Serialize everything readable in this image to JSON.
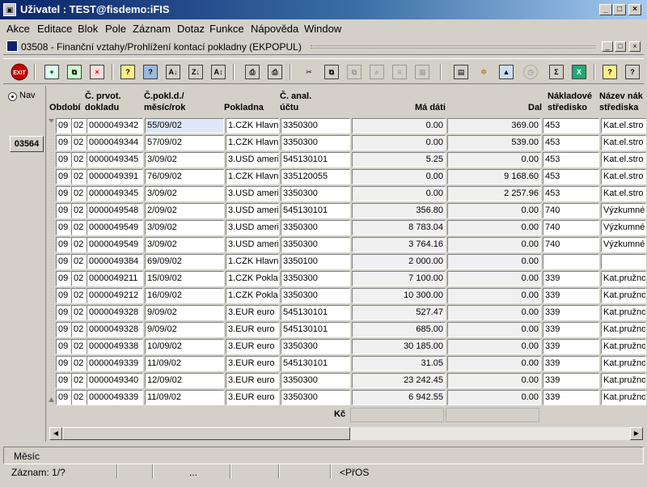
{
  "window": {
    "title": "Uživatel : TEST@fisdemo:iFIS"
  },
  "menu": [
    "Akce",
    "Editace",
    "Blok",
    "Pole",
    "Záznam",
    "Dotaz",
    "Funkce",
    "Nápověda",
    "Window"
  ],
  "form": {
    "title": "03508 - Finanční vztahy/Prohlížení kontací pokladny (EKPOPUL)"
  },
  "toolbar": {
    "exit_label": "EXIT"
  },
  "nav": {
    "label": "Nav",
    "record_button": "03564"
  },
  "columns": {
    "obdobi": "Období",
    "prvot_1": "Č. prvot.",
    "prvot_2": "dokladu",
    "pokl_1": "Č.pokl.d./",
    "pokl_2": "měsíc/rok",
    "pokladna": "Pokladna",
    "anal_1": "Č. anal.",
    "anal_2": "účtu",
    "ma_dati": "Má dáti",
    "dal": "Dal",
    "nakl_1": "Nákladové",
    "nakl_2": "středisko",
    "nazev_1": "Název nák",
    "nazev_2": "střediska"
  },
  "rows": [
    {
      "rok": "09",
      "mes": "02",
      "doklad": "0000049342",
      "pokl_d": "55/09/02",
      "pokladna": "1.CZK Hlavní",
      "ucet": "3350300",
      "md": "0.00",
      "dal": "369.00",
      "stred": "453",
      "nazev": "Kat.el.stro"
    },
    {
      "rok": "09",
      "mes": "02",
      "doklad": "0000049344",
      "pokl_d": "57/09/02",
      "pokladna": "1.CZK Hlavní",
      "ucet": "3350300",
      "md": "0.00",
      "dal": "539.00",
      "stred": "453",
      "nazev": "Kat.el.stro"
    },
    {
      "rok": "09",
      "mes": "02",
      "doklad": "0000049345",
      "pokl_d": "3/09/02",
      "pokladna": "3.USD americ",
      "ucet": "545130101",
      "md": "5.25",
      "dal": "0.00",
      "stred": "453",
      "nazev": "Kat.el.stro"
    },
    {
      "rok": "09",
      "mes": "02",
      "doklad": "0000049391",
      "pokl_d": "76/09/02",
      "pokladna": "1.CZK Hlavní",
      "ucet": "335120055",
      "md": "0.00",
      "dal": "9 168.60",
      "stred": "453",
      "nazev": "Kat.el.stro"
    },
    {
      "rok": "09",
      "mes": "02",
      "doklad": "0000049345",
      "pokl_d": "3/09/02",
      "pokladna": "3.USD americ",
      "ucet": "3350300",
      "md": "0.00",
      "dal": "2 257.96",
      "stred": "453",
      "nazev": "Kat.el.stro"
    },
    {
      "rok": "09",
      "mes": "02",
      "doklad": "0000049548",
      "pokl_d": "2/09/02",
      "pokladna": "3.USD americ",
      "ucet": "545130101",
      "md": "356.80",
      "dal": "0.00",
      "stred": "740",
      "nazev": "Výzkumné"
    },
    {
      "rok": "09",
      "mes": "02",
      "doklad": "0000049549",
      "pokl_d": "3/09/02",
      "pokladna": "3.USD americ",
      "ucet": "3350300",
      "md": "8 783.04",
      "dal": "0.00",
      "stred": "740",
      "nazev": "Výzkumné"
    },
    {
      "rok": "09",
      "mes": "02",
      "doklad": "0000049549",
      "pokl_d": "3/09/02",
      "pokladna": "3.USD americ",
      "ucet": "3350300",
      "md": "3 764.16",
      "dal": "0.00",
      "stred": "740",
      "nazev": "Výzkumné"
    },
    {
      "rok": "09",
      "mes": "02",
      "doklad": "0000049384",
      "pokl_d": "69/09/02",
      "pokladna": "1.CZK Hlavní",
      "ucet": "3350100",
      "md": "2 000.00",
      "dal": "0.00",
      "stred": "",
      "nazev": ""
    },
    {
      "rok": "09",
      "mes": "02",
      "doklad": "0000049211",
      "pokl_d": "15/09/02",
      "pokladna": "1.CZK Poklac",
      "ucet": "3350300",
      "md": "7 100.00",
      "dal": "0.00",
      "stred": "339",
      "nazev": "Kat.pružno"
    },
    {
      "rok": "09",
      "mes": "02",
      "doklad": "0000049212",
      "pokl_d": "16/09/02",
      "pokladna": "1.CZK Poklac",
      "ucet": "3350300",
      "md": "10 300.00",
      "dal": "0.00",
      "stred": "339",
      "nazev": "Kat.pružno"
    },
    {
      "rok": "09",
      "mes": "02",
      "doklad": "0000049328",
      "pokl_d": "9/09/02",
      "pokladna": "3.EUR euro",
      "ucet": "545130101",
      "md": "527.47",
      "dal": "0.00",
      "stred": "339",
      "nazev": "Kat.pružno"
    },
    {
      "rok": "09",
      "mes": "02",
      "doklad": "0000049328",
      "pokl_d": "9/09/02",
      "pokladna": "3.EUR euro",
      "ucet": "545130101",
      "md": "685.00",
      "dal": "0.00",
      "stred": "339",
      "nazev": "Kat.pružno"
    },
    {
      "rok": "09",
      "mes": "02",
      "doklad": "0000049338",
      "pokl_d": "10/09/02",
      "pokladna": "3.EUR euro",
      "ucet": "3350300",
      "md": "30 185.00",
      "dal": "0.00",
      "stred": "339",
      "nazev": "Kat.pružno"
    },
    {
      "rok": "09",
      "mes": "02",
      "doklad": "0000049339",
      "pokl_d": "11/09/02",
      "pokladna": "3.EUR euro",
      "ucet": "545130101",
      "md": "31.05",
      "dal": "0.00",
      "stred": "339",
      "nazev": "Kat.pružno"
    },
    {
      "rok": "09",
      "mes": "02",
      "doklad": "0000049340",
      "pokl_d": "12/09/02",
      "pokladna": "3.EUR euro",
      "ucet": "3350300",
      "md": "23 242.45",
      "dal": "0.00",
      "stred": "339",
      "nazev": "Kat.pružno"
    },
    {
      "rok": "09",
      "mes": "02",
      "doklad": "0000049339",
      "pokl_d": "11/09/02",
      "pokladna": "3.EUR euro",
      "ucet": "3350300",
      "md": "6 942.55",
      "dal": "0.00",
      "stred": "339",
      "nazev": "Kat.pružno"
    }
  ],
  "totals": {
    "label": "Kč"
  },
  "status": {
    "message": "Měsíc",
    "record": "Záznam: 1/?",
    "ellipsis": "...",
    "mode": "<PřOS"
  }
}
